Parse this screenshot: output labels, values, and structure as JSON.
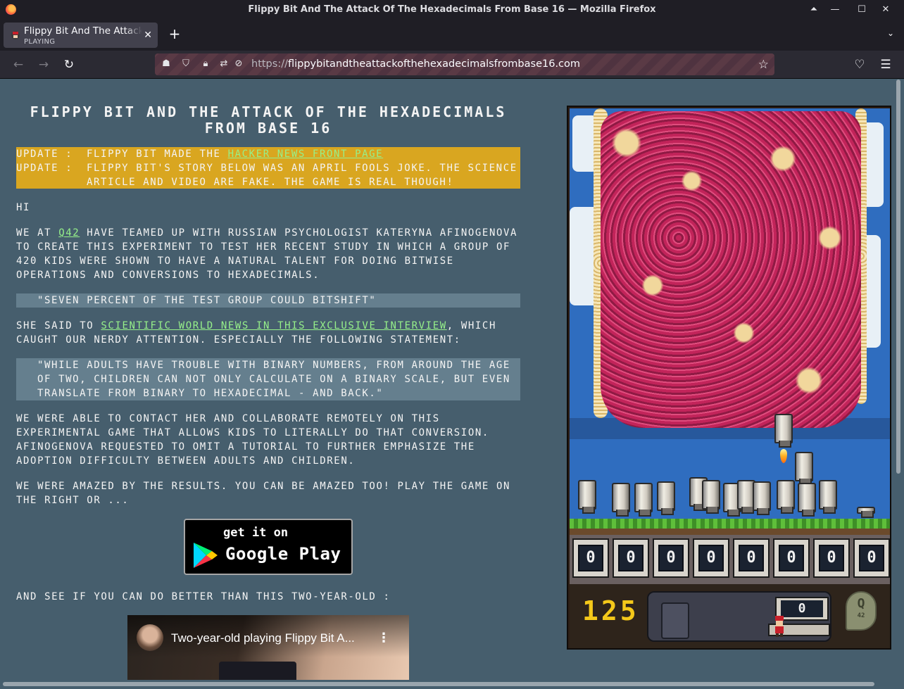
{
  "window": {
    "title": "Flippy Bit And The Attack Of The Hexadecimals From Base 16 — Mozilla Firefox"
  },
  "tab": {
    "title": "Flippy Bit And The Attack Of The Hexadecimals From Base 16",
    "status": "PLAYING"
  },
  "urlbar": {
    "protocol": "https://",
    "domain": "flippybitandtheattackofthehexadecimalsfrombase16.com"
  },
  "article": {
    "heading": "Flippy Bit And The Attack Of The Hexadecimals From Base 16",
    "updates": [
      {
        "label": "Update :",
        "text": "Flippy Bit made the ",
        "link": "Hacker News front page"
      },
      {
        "label": "Update :",
        "text": "Flippy Bit's story below was an April Fools joke. The science article and video are fake. The game is real though!"
      }
    ],
    "greeting": "Hi",
    "p1_before": "We at ",
    "p1_link": "Q42",
    "p1_after": " have teamed up with Russian psychologist Kateryna Afinogenova to create this experiment to test her recent study in which a group of 420 kids were shown to have a natural talent for doing bitwise operations and conversions to hexadecimals.",
    "quote1": "\"Seven percent of the test group could bitshift\"",
    "p2_before": "She said to ",
    "p2_link": "Scientific World News in this exclusive interview",
    "p2_after": ", which caught our nerdy attention. Especially the following statement:",
    "quote2": "\"While adults have trouble with binary numbers, from around the age of two, children can not only calculate on a binary scale, but even translate from binary to hexadecimal - and back.\"",
    "p3": "We were able to contact her and collaborate remotely on this experimental game that allows kids to literally do that conversion. Afinogenova requested to omit a tutorial to further emphasize the adoption difficulty between adults and children.",
    "p4": "We were amazed by the results. You can be amazed too! Play the game on the right or ...",
    "gplay_line1": "get it on",
    "gplay_line2": "Google Play",
    "p5": "And see if you can do better than this two-year-old :",
    "video_title": "Two-year-old playing Flippy Bit A..."
  },
  "game": {
    "bits": [
      "0",
      "0",
      "0",
      "0",
      "0",
      "0",
      "0",
      "0"
    ],
    "score": "125",
    "target": "0",
    "badge_letter": "Q",
    "badge_number": "42"
  }
}
